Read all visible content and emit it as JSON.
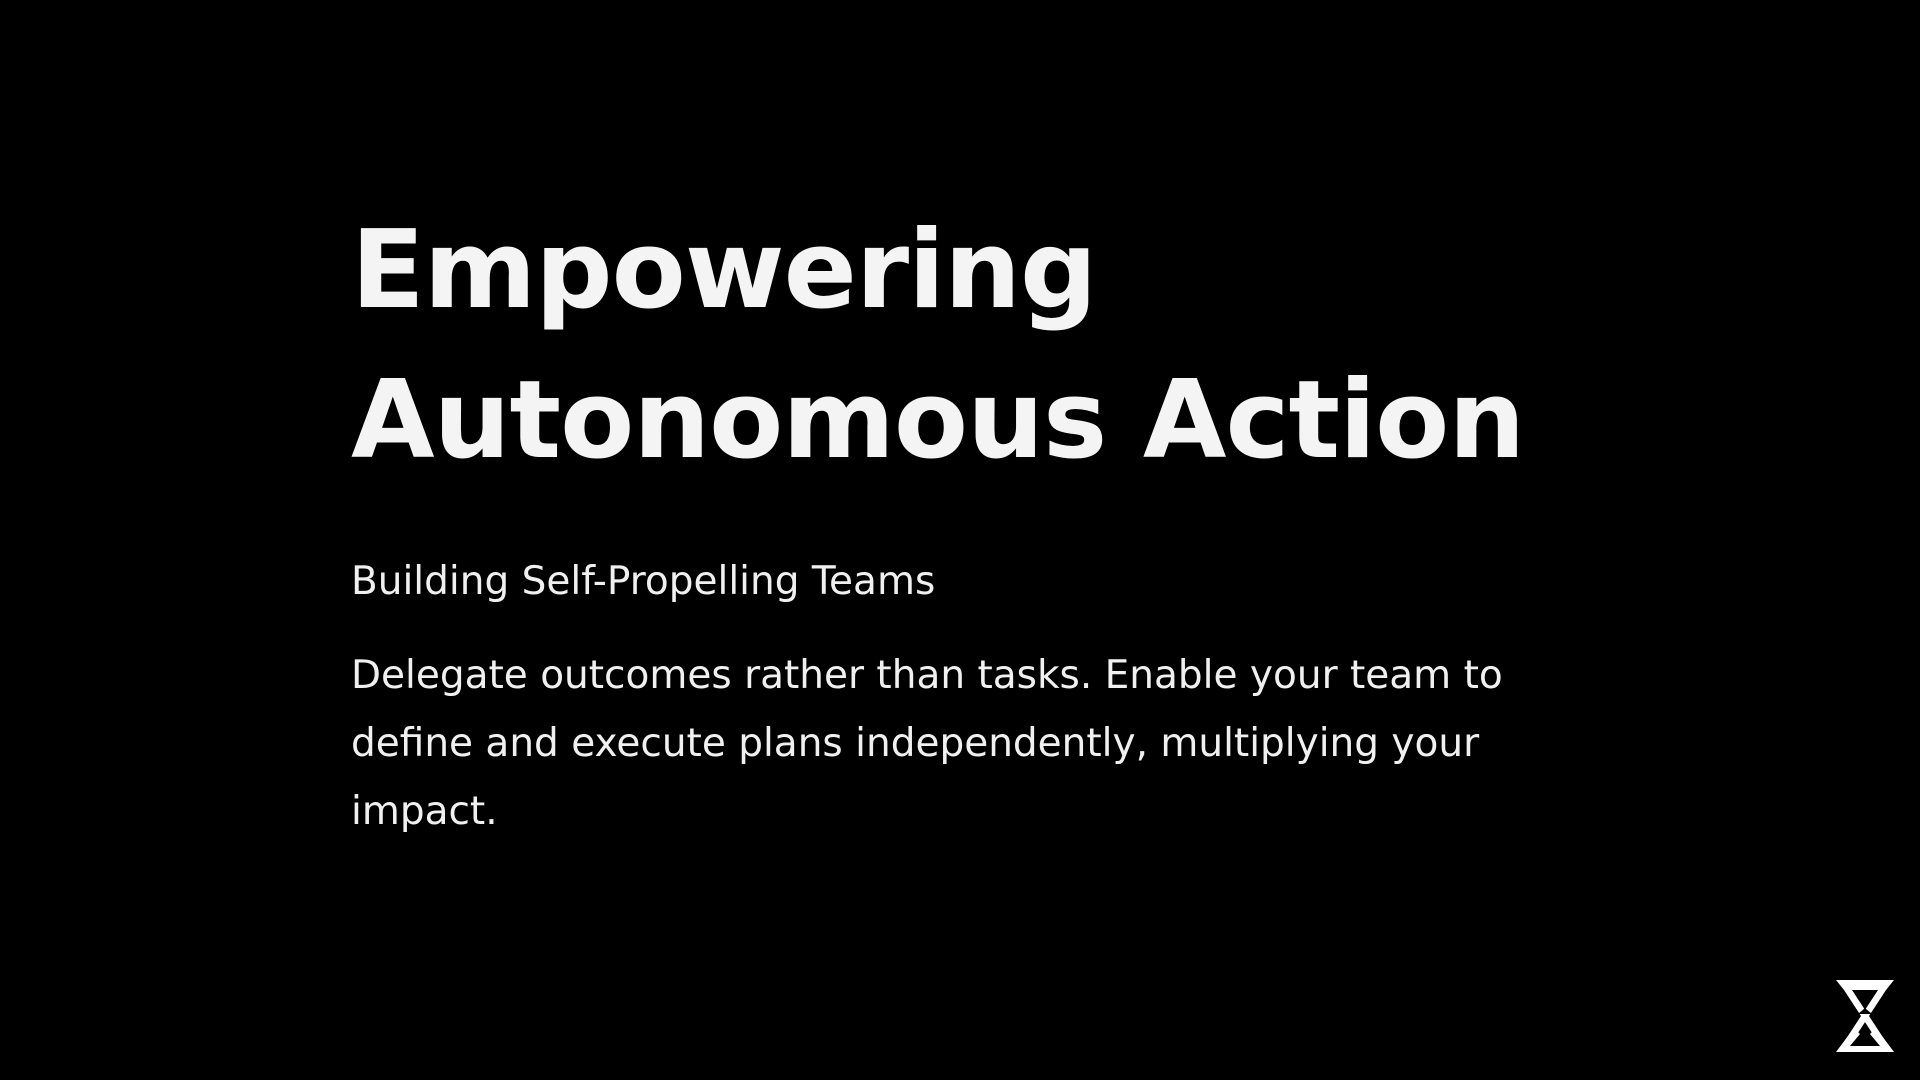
{
  "slide": {
    "title_line_1": "Empowering",
    "title_line_2": "Autonomous Action",
    "subtitle": "Building Self-Propelling Teams",
    "body": "Delegate outcomes rather than tasks. Enable your team to define and execute plans independently, multiplying your impact."
  },
  "logo": {
    "icon": "hourglass-x-logo-icon",
    "color": "#ffffff"
  },
  "colors": {
    "background": "#000000",
    "text": "#f2f2f2"
  }
}
